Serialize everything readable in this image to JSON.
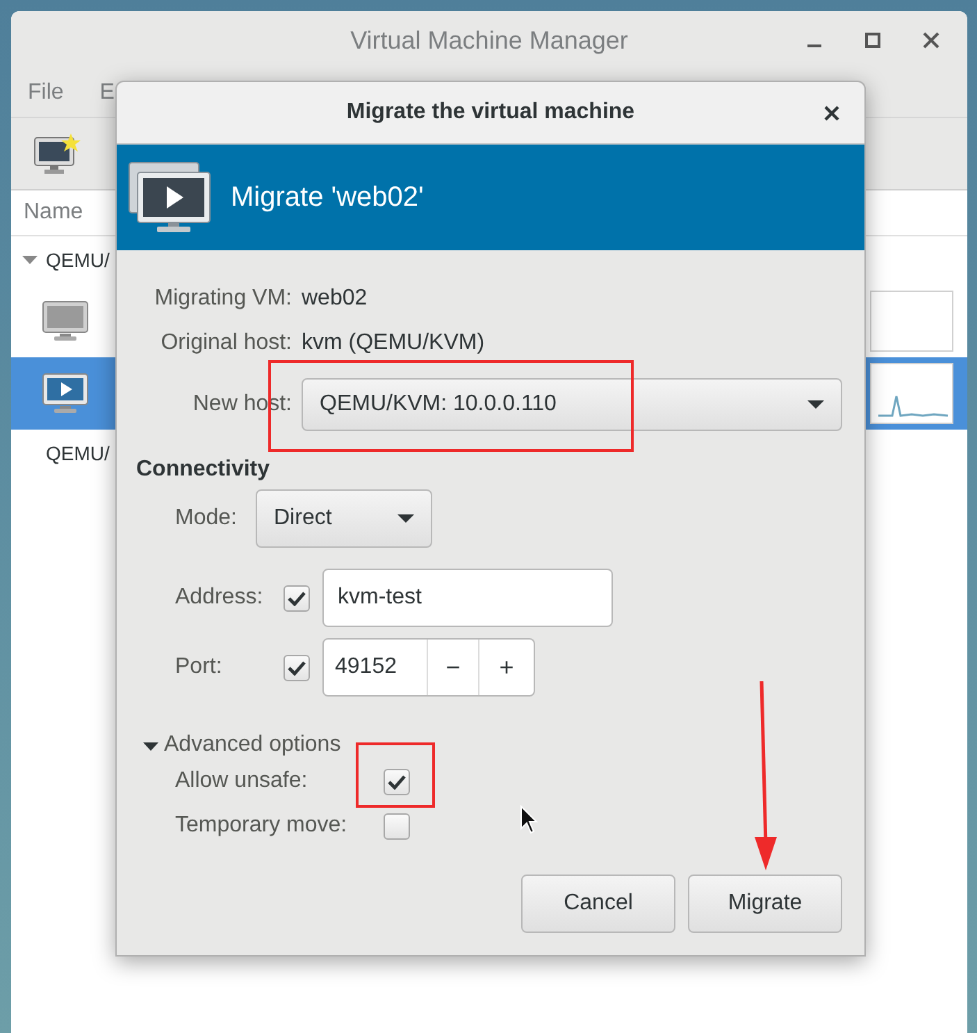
{
  "main_window": {
    "title": "Virtual Machine Manager",
    "menu": [
      "File",
      "E"
    ],
    "list_header": "Name",
    "rows": [
      {
        "kind": "group",
        "label": "QEMU/",
        "expanded": true
      },
      {
        "kind": "vm",
        "selected": false,
        "running": false
      },
      {
        "kind": "vm",
        "selected": true,
        "running": true
      },
      {
        "kind": "group",
        "label": "QEMU/"
      }
    ]
  },
  "dialog": {
    "title": "Migrate the virtual machine",
    "header": "Migrate 'web02'",
    "fields": [
      {
        "label": "Migrating VM:",
        "value": "web02"
      },
      {
        "label": "Original host:",
        "value": "kvm (QEMU/KVM)"
      }
    ],
    "new_host": {
      "label": "New host:",
      "value": "QEMU/KVM: 10.0.0.110"
    },
    "connectivity": {
      "heading": "Connectivity",
      "mode": {
        "label": "Mode:",
        "value": "Direct"
      },
      "address": {
        "label": "Address:",
        "checked": true,
        "value": "kvm-test"
      },
      "port": {
        "label": "Port:",
        "checked": true,
        "value": "49152",
        "decrement": "−",
        "increment": "+"
      }
    },
    "advanced": {
      "label": "Advanced options",
      "expanded": true,
      "options": [
        {
          "label": "Allow unsafe:",
          "checked": true
        },
        {
          "label": "Temporary move:",
          "checked": false
        }
      ]
    },
    "buttons": [
      "Cancel",
      "Migrate"
    ]
  }
}
